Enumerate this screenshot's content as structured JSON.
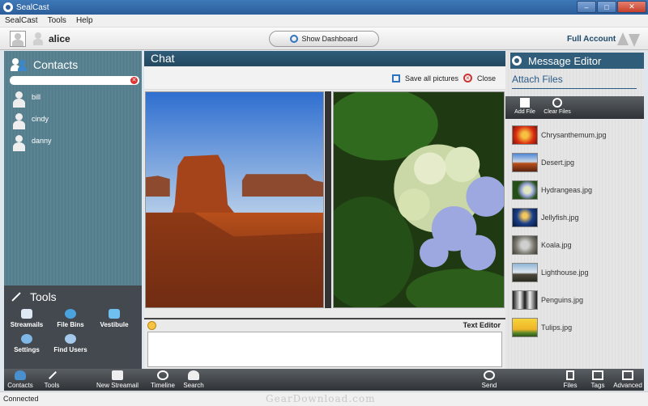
{
  "window": {
    "title": "SealCast"
  },
  "menu": [
    "SealCast",
    "Tools",
    "Help"
  ],
  "topbar": {
    "username": "alice",
    "dashboard_button": "Show Dashboard",
    "account": "Full Account"
  },
  "contacts": {
    "title": "Contacts",
    "search_value": "",
    "items": [
      "bill",
      "cindy",
      "danny"
    ]
  },
  "tools": {
    "title": "Tools",
    "items": [
      "Streamails",
      "File Bins",
      "Vestibule",
      "Settings",
      "Find Users"
    ]
  },
  "bottom_nav": {
    "contacts": "Contacts",
    "tools": "Tools",
    "new_streamail": "New Streamail",
    "timeline": "Timeline",
    "search": "Search",
    "send": "Send",
    "files": "Files",
    "tags": "Tags",
    "advanced": "Advanced"
  },
  "chat": {
    "title": "Chat",
    "save_all": "Save all pictures",
    "close": "Close",
    "text_editor": "Text Editor"
  },
  "message_editor": {
    "title": "Message Editor",
    "attach_files": "Attach Files",
    "add_file": "Add File",
    "clear_files": "Clear Files",
    "files": [
      "Chrysanthemum.jpg",
      "Desert.jpg",
      "Hydrangeas.jpg",
      "Jellyfish.jpg",
      "Koala.jpg",
      "Lighthouse.jpg",
      "Penguins.jpg",
      "Tulips.jpg"
    ]
  },
  "status": "Connected",
  "watermark": "GearDownload.com",
  "colors": {
    "header_blue": "#2f5d7a",
    "dark_bar": "#43494e",
    "accent_blue": "#2f73c0"
  }
}
